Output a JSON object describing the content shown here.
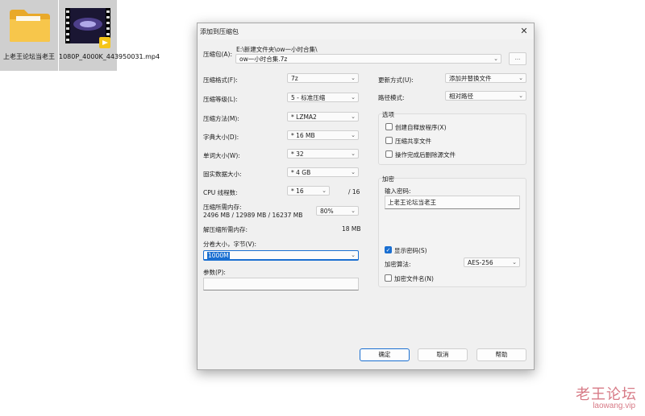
{
  "desktop": {
    "items": [
      {
        "label": "上老王论坛当老王",
        "icon": "folder-icon"
      },
      {
        "label": "1080P_4000K_443950031.mp4",
        "icon": "video-file-icon"
      }
    ]
  },
  "watermark": {
    "title": "老王论坛",
    "url": "laowang.vip"
  },
  "dialog": {
    "title": "添加到压缩包",
    "archive": {
      "label": "压缩包(A):",
      "path": "E:\\新建文件夹\\ow一小时合集\\",
      "name": "ow一小时合集.7z",
      "browse": "..."
    },
    "left": {
      "format": {
        "label": "压缩格式(F):",
        "value": "7z"
      },
      "level": {
        "label": "压缩等级(L):",
        "value": "5 - 标准压缩"
      },
      "method": {
        "label": "压缩方法(M):",
        "value": "* LZMA2"
      },
      "dict": {
        "label": "字典大小(D):",
        "value": "* 16 MB"
      },
      "word": {
        "label": "单词大小(W):",
        "value": "* 32"
      },
      "solid": {
        "label": "固实数据大小:",
        "value": "* 4 GB"
      },
      "cpu": {
        "label": "CPU 线程数:",
        "value": "* 16",
        "total": "/ 16"
      },
      "mem": {
        "label": "压缩所需内存:",
        "detail": "2496 MB / 12989 MB / 16237 MB",
        "value": "80%"
      },
      "decomp": {
        "label": "解压缩所需内存:",
        "value": "18 MB"
      },
      "split": {
        "label": "分卷大小，字节(V):",
        "value": "1000M"
      },
      "params": {
        "label": "参数(P):",
        "value": ""
      }
    },
    "right": {
      "update": {
        "label": "更新方式(U):",
        "value": "添加并替换文件"
      },
      "pathmode": {
        "label": "路径模式:",
        "value": "相对路径"
      },
      "options": {
        "title": "选项",
        "sfx": "创建自释放程序(X)",
        "shared": "压缩共享文件",
        "delete": "操作完成后删除源文件"
      },
      "encryption": {
        "title": "加密",
        "password_label": "输入密码:",
        "password": "上老王论坛当老王",
        "show_password": "显示密码(S)",
        "method_label": "加密算法:",
        "method": "AES-256",
        "encrypt_names": "加密文件名(N)"
      }
    },
    "buttons": {
      "ok": "确定",
      "cancel": "取消",
      "help": "帮助"
    }
  }
}
